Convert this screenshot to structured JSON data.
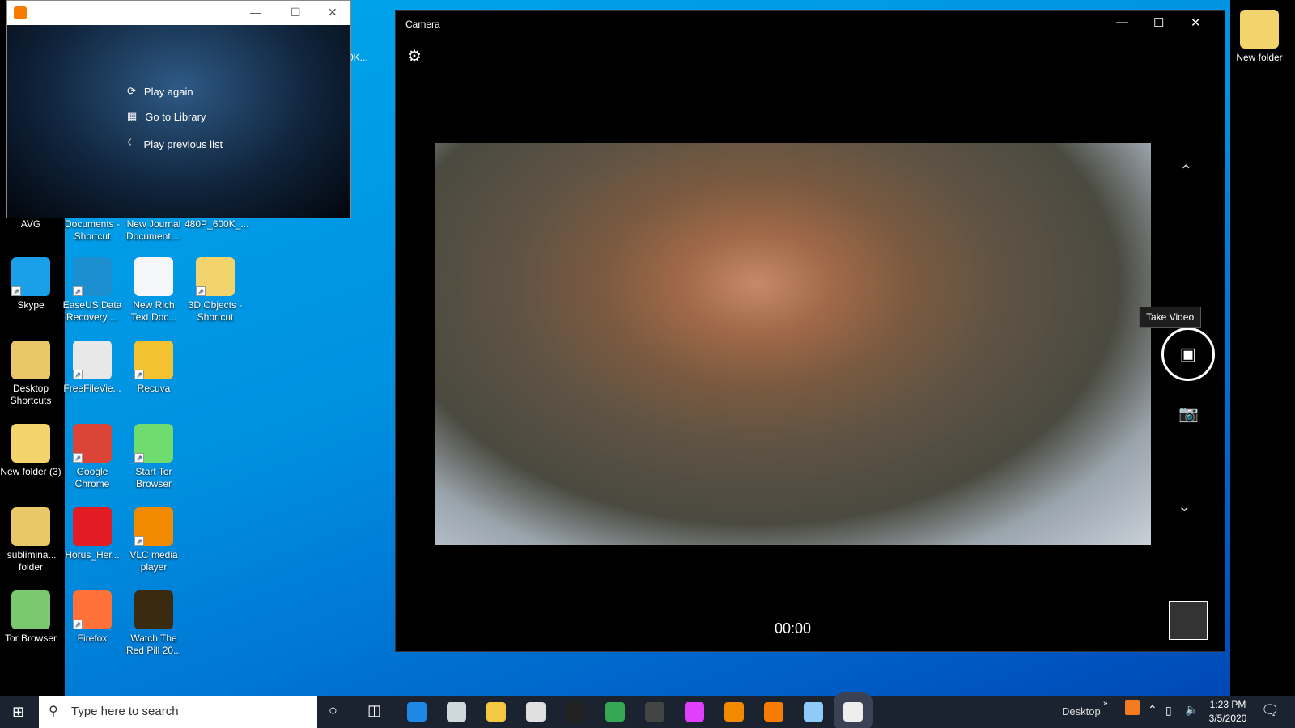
{
  "desktop": {
    "icons": [
      {
        "label": "AVG",
        "col": 0,
        "row": -1
      },
      {
        "label": "Documents - Shortcut",
        "col": 1,
        "row": -1
      },
      {
        "label": "New Journal Document....",
        "col": 2,
        "row": -1
      },
      {
        "label": "480P_600K_...",
        "col": 3,
        "row": -1
      },
      {
        "label": "Skype",
        "col": 0,
        "row": 0,
        "color": "#1aa0e8",
        "shortcut": true
      },
      {
        "label": "EaseUS Data Recovery ...",
        "col": 1,
        "row": 0,
        "color": "#1b8fd0",
        "shortcut": true
      },
      {
        "label": "New Rich Text Doc...",
        "col": 2,
        "row": 0,
        "color": "#f4f6fa"
      },
      {
        "label": "3D Objects - Shortcut",
        "col": 3,
        "row": 0,
        "color": "#f3d36b",
        "shortcut": true
      },
      {
        "label": "Desktop Shortcuts",
        "col": 0,
        "row": 1,
        "color": "#e9c86a"
      },
      {
        "label": "FreeFileVie...",
        "col": 1,
        "row": 1,
        "color": "#e8e8e8",
        "shortcut": true
      },
      {
        "label": "Recuva",
        "col": 2,
        "row": 1,
        "color": "#f2c230",
        "shortcut": true
      },
      {
        "label": "New folder (3)",
        "col": 0,
        "row": 2,
        "color": "#f3d36b"
      },
      {
        "label": "Google Chrome",
        "col": 1,
        "row": 2,
        "color": "#db4437",
        "shortcut": true
      },
      {
        "label": "Start Tor Browser",
        "col": 2,
        "row": 2,
        "color": "#6fdc6f",
        "shortcut": true
      },
      {
        "label": "'sublimina... folder",
        "col": 0,
        "row": 3,
        "color": "#e9c86a"
      },
      {
        "label": "Horus_Her...",
        "col": 1,
        "row": 3,
        "color": "#e31b23"
      },
      {
        "label": "VLC media player",
        "col": 2,
        "row": 3,
        "color": "#f28a00",
        "shortcut": true
      },
      {
        "label": "Tor Browser",
        "col": 0,
        "row": 4,
        "color": "#7bc96f"
      },
      {
        "label": "Firefox",
        "col": 1,
        "row": 4,
        "color": "#ff7139",
        "shortcut": true
      },
      {
        "label": "Watch The Red Pill 20...",
        "col": 2,
        "row": 4,
        "color": "#3a2a10"
      }
    ],
    "right_icon": {
      "label": "New folder",
      "color": "#f3d36b"
    },
    "partial_label": "0K..."
  },
  "media_player": {
    "items": [
      {
        "label": "Play again",
        "icon": "replay-icon"
      },
      {
        "label": "Go to Library",
        "icon": "library-icon"
      },
      {
        "label": "Play previous list",
        "icon": "back-arrow-icon"
      }
    ]
  },
  "camera": {
    "title": "Camera",
    "tooltip": "Take Video",
    "timer": "00:00"
  },
  "taskbar": {
    "search_placeholder": "Type here to search",
    "desktop_label": "Desktop",
    "time": "1:23 PM",
    "date": "3/5/2020",
    "apps": [
      {
        "name": "edge",
        "color": "#1e88e5"
      },
      {
        "name": "store",
        "color": "#cfd8dc"
      },
      {
        "name": "file-explorer",
        "color": "#f3c843"
      },
      {
        "name": "mail",
        "color": "#e0e0e0"
      },
      {
        "name": "amazon",
        "color": "#222"
      },
      {
        "name": "tripadvisor",
        "color": "#34a853"
      },
      {
        "name": "app-circle",
        "color": "#444"
      },
      {
        "name": "color-app",
        "color": "#e040fb"
      },
      {
        "name": "vlc",
        "color": "#f28a00"
      },
      {
        "name": "media-player",
        "color": "#f57c00"
      },
      {
        "name": "paint",
        "color": "#90caf9"
      },
      {
        "name": "camera",
        "color": "#eee"
      }
    ]
  }
}
